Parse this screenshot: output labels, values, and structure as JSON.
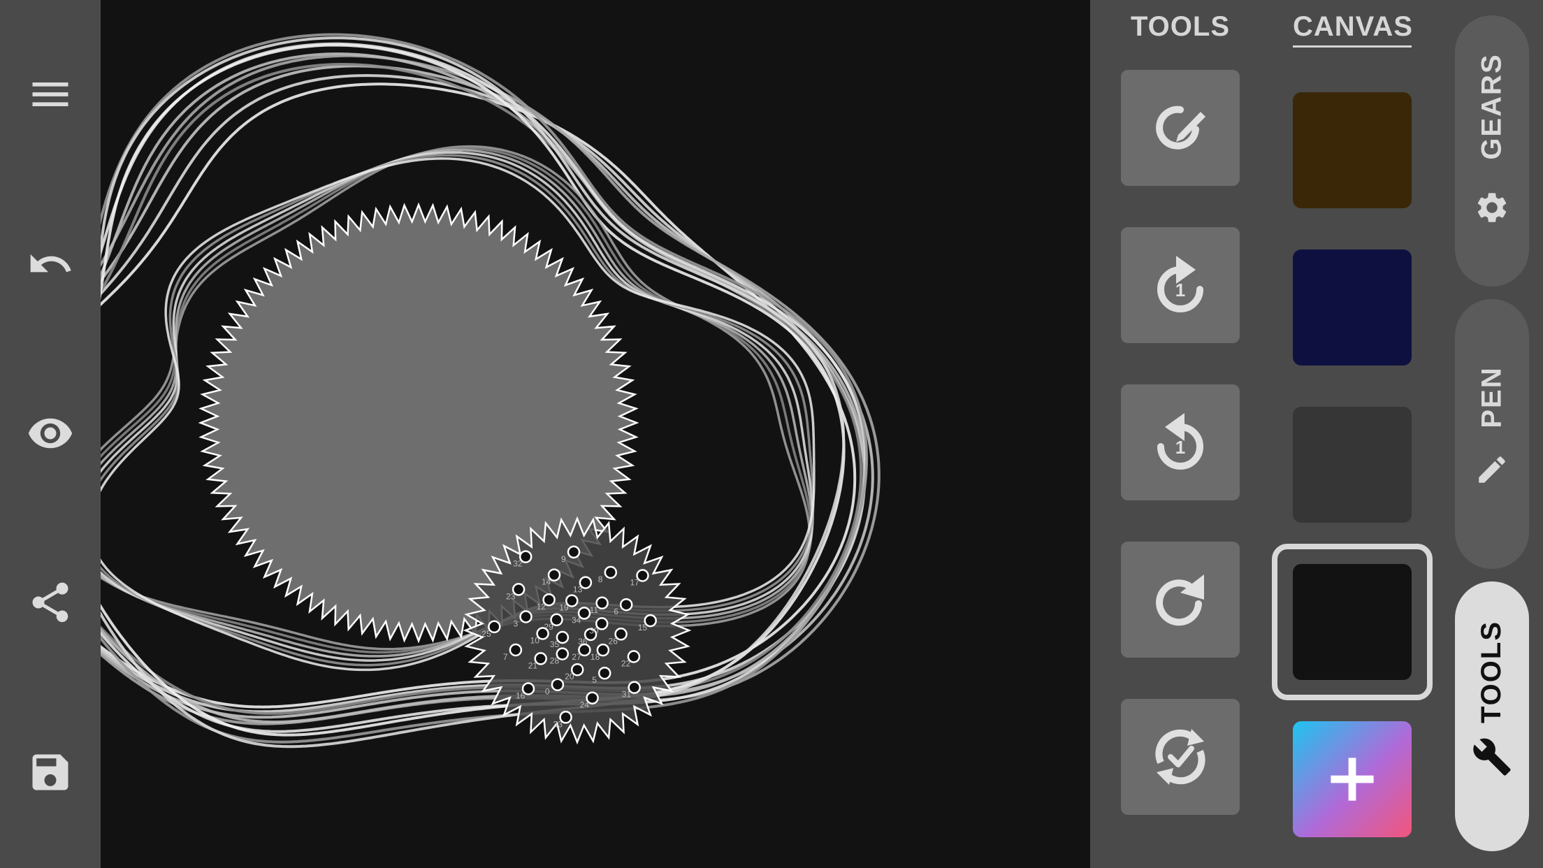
{
  "left_toolbar": {
    "items": [
      {
        "name": "menu-icon"
      },
      {
        "name": "undo-icon"
      },
      {
        "name": "eye-icon"
      },
      {
        "name": "share-icon"
      },
      {
        "name": "save-icon"
      }
    ]
  },
  "right_panel": {
    "tabs": {
      "tools": "TOOLS",
      "canvas": "CANVAS"
    },
    "tool_buttons": [
      {
        "name": "pencil-circle-icon"
      },
      {
        "name": "rotate-forward-one-icon",
        "badge": "1"
      },
      {
        "name": "rotate-back-one-icon",
        "badge": "1"
      },
      {
        "name": "redo-icon"
      },
      {
        "name": "auto-complete-icon"
      }
    ],
    "swatches": [
      "#3a2708",
      "#0e1140",
      "#363636",
      "#121212"
    ],
    "selected_swatch_index": 3,
    "add_swatch_icon": "plus-icon",
    "side_tabs": [
      {
        "label": "GEARS",
        "icon": "gear-icon"
      },
      {
        "label": "PEN",
        "icon": "pen-icon"
      },
      {
        "label": "TOOLS",
        "icon": "wrench-icon",
        "active": true
      }
    ]
  },
  "canvas": {
    "background": "#121212",
    "ring_gear_color": "#6e6e6e",
    "hole_labels": [
      "36",
      "35",
      "34",
      "27",
      "29",
      "30",
      "28",
      "19",
      "18",
      "10",
      "11",
      "20",
      "12",
      "26",
      "21",
      "13",
      "5",
      "3",
      "6",
      "0",
      "14",
      "22",
      "7",
      "8",
      "24",
      "23",
      "15",
      "16",
      "9",
      "31",
      "25",
      "17",
      "33",
      "32"
    ]
  }
}
